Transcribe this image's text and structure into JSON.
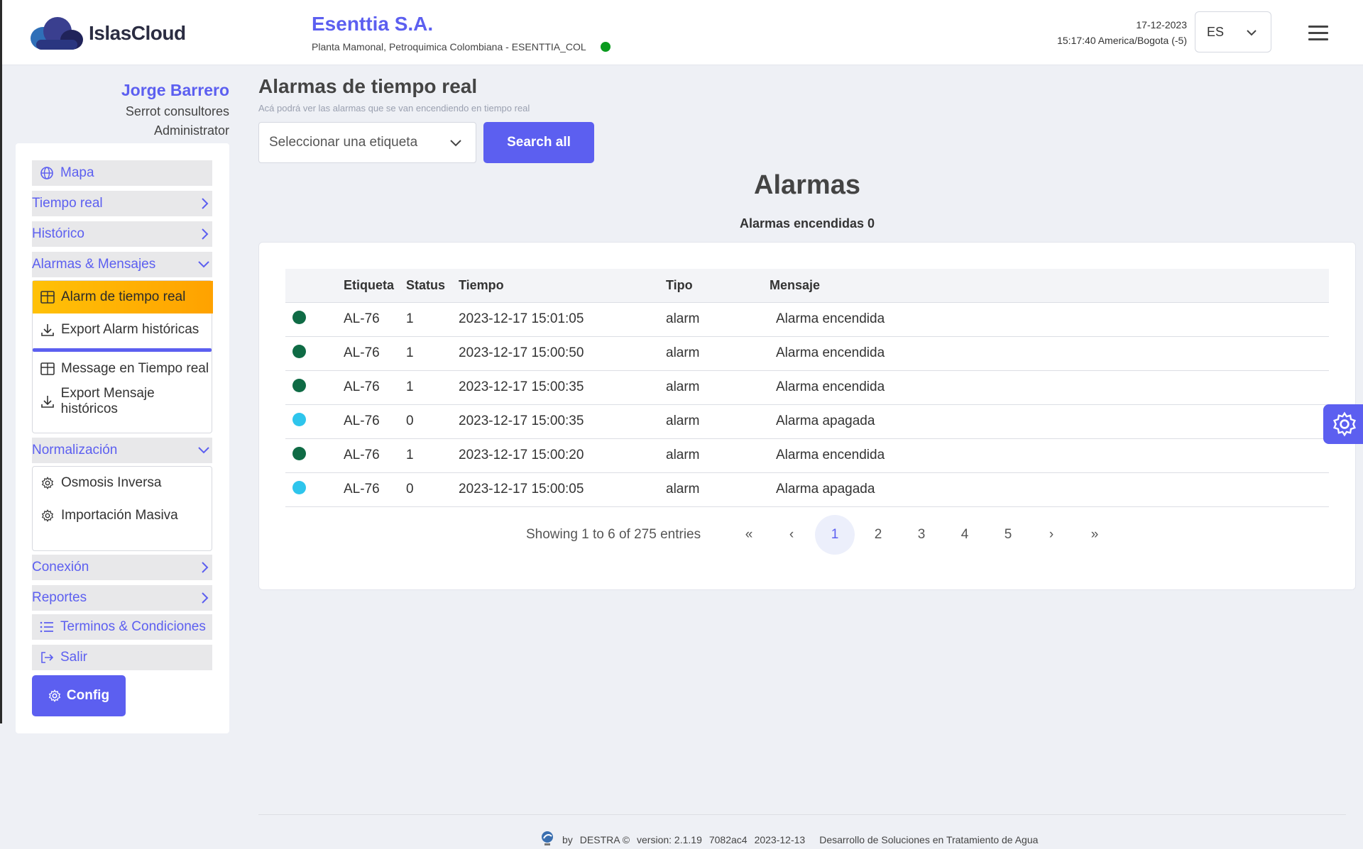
{
  "header": {
    "logo_text": "IslasCloud",
    "company_name": "Esenttia S.A.",
    "company_sub": "Planta Mamonal, Petroquimica Colombiana - ESENTTIA_COL",
    "date": "17-12-2023",
    "time": "15:17:40 America/Bogota (-5)",
    "language": "ES",
    "status_color": "#0a9a1e"
  },
  "user": {
    "name": "Jorge Barrero",
    "company": "Serrot consultores",
    "role": "Administrator"
  },
  "sidebar": {
    "map": "Mapa",
    "realtime": "Tiempo real",
    "history": "Histórico",
    "alarms_messages": "Alarmas & Mensajes",
    "alarms_sub": [
      {
        "label": "Alarm de tiempo real",
        "icon": "table-icon"
      },
      {
        "label": "Export Alarm históricas",
        "icon": "download-icon"
      },
      {
        "label": "Message en Tiempo real",
        "icon": "table-icon"
      },
      {
        "label": "Export Mensaje históricos",
        "icon": "download-icon"
      }
    ],
    "normalization": "Normalización",
    "normalization_sub": [
      {
        "label": "Osmosis Inversa",
        "icon": "gear-icon"
      },
      {
        "label": "Importación Masiva",
        "icon": "gear-icon"
      }
    ],
    "connection": "Conexión",
    "reports": "Reportes",
    "terms": "Terminos & Condiciones",
    "logout": "Salir",
    "config": "Config"
  },
  "main": {
    "title": "Alarmas de tiempo real",
    "subtitle": "Acá podrá ver las alarmas que se van encendiendo en tiempo real",
    "tag_placeholder": "Seleccionar una etiqueta",
    "search_all": "Search all",
    "alarms_title": "Alarmas",
    "alarms_on": "Alarmas encendidas 0"
  },
  "table": {
    "columns": [
      "",
      "Etiqueta",
      "Status",
      "Tiempo",
      "Tipo",
      "Mensaje"
    ],
    "rows": [
      {
        "color": "#0f6b45",
        "tag": "AL-76",
        "status": "1",
        "time": "2023-12-17 15:01:05",
        "type": "alarm",
        "message": "Alarma encendida"
      },
      {
        "color": "#0f6b45",
        "tag": "AL-76",
        "status": "1",
        "time": "2023-12-17 15:00:50",
        "type": "alarm",
        "message": "Alarma encendida"
      },
      {
        "color": "#0f6b45",
        "tag": "AL-76",
        "status": "1",
        "time": "2023-12-17 15:00:35",
        "type": "alarm",
        "message": "Alarma encendida"
      },
      {
        "color": "#2ec5ec",
        "tag": "AL-76",
        "status": "0",
        "time": "2023-12-17 15:00:35",
        "type": "alarm",
        "message": "Alarma apagada"
      },
      {
        "color": "#0f6b45",
        "tag": "AL-76",
        "status": "1",
        "time": "2023-12-17 15:00:20",
        "type": "alarm",
        "message": "Alarma encendida"
      },
      {
        "color": "#2ec5ec",
        "tag": "AL-76",
        "status": "0",
        "time": "2023-12-17 15:00:05",
        "type": "alarm",
        "message": "Alarma apagada"
      }
    ]
  },
  "pagination": {
    "info": "Showing 1 to 6 of 275 entries",
    "first": "«",
    "prev": "‹",
    "pages": [
      "1",
      "2",
      "3",
      "4",
      "5"
    ],
    "current": "1",
    "next": "›",
    "last": "»"
  },
  "footer": {
    "by": "by",
    "brand": "DESTRA ©",
    "version": "version: 2.1.19",
    "commit": "7082ac4",
    "date": "2023-12-13",
    "tagline": "Desarrollo de Soluciones en Tratamiento de Agua"
  },
  "colors": {
    "accent": "#5c5ff0",
    "active_menu": "#ffa200"
  }
}
